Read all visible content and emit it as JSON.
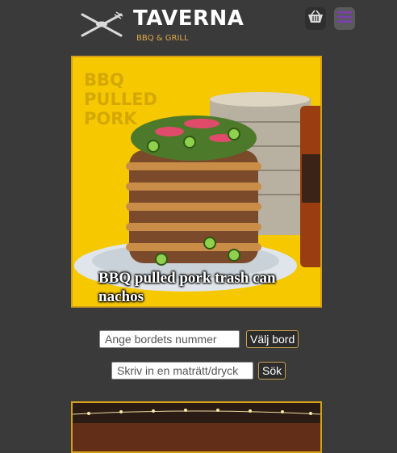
{
  "header": {
    "brand": "TAVERNA",
    "tagline": "BBQ & GRILL",
    "logo_icon": "fork-knife-spoon-icon",
    "cart_icon": "basket-icon",
    "menu_icon": "hamburger-menu-icon"
  },
  "hero": {
    "background_text": [
      "BBQ",
      "PULLED",
      "PORK"
    ],
    "caption": "BBQ pulled pork trash can nachos"
  },
  "table_form": {
    "placeholder": "Ange bordets nummer",
    "button_label": "Välj bord"
  },
  "search_form": {
    "placeholder": "Skriv in en maträtt/dryck",
    "button_label": "Sök"
  },
  "colors": {
    "background": "#3a3a3a",
    "accent": "#d4a017",
    "hero_bg": "#f6c800",
    "menu_lines": "#7a3fb0"
  }
}
